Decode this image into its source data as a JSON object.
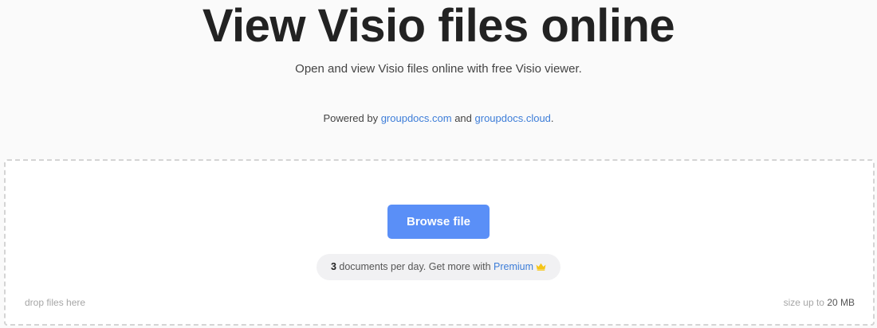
{
  "hero": {
    "title": "View Visio files online",
    "subtitle": "Open and view Visio files online with free Visio viewer.",
    "powered_prefix": "Powered by ",
    "link1": "groupdocs.com",
    "and_text": " and ",
    "link2": "groupdocs.cloud",
    "period": "."
  },
  "dropzone": {
    "browse_label": "Browse file",
    "limit_count": "3",
    "limit_text": " documents per day. Get more with ",
    "premium_label": "Premium",
    "drop_hint": "drop files here",
    "size_prefix": "size up to ",
    "size_value": "20 MB"
  },
  "colors": {
    "accent": "#5a8ff7",
    "link": "#3d7dd8",
    "crown": "#f5c518"
  },
  "icons": {
    "premium": "crown-icon"
  }
}
